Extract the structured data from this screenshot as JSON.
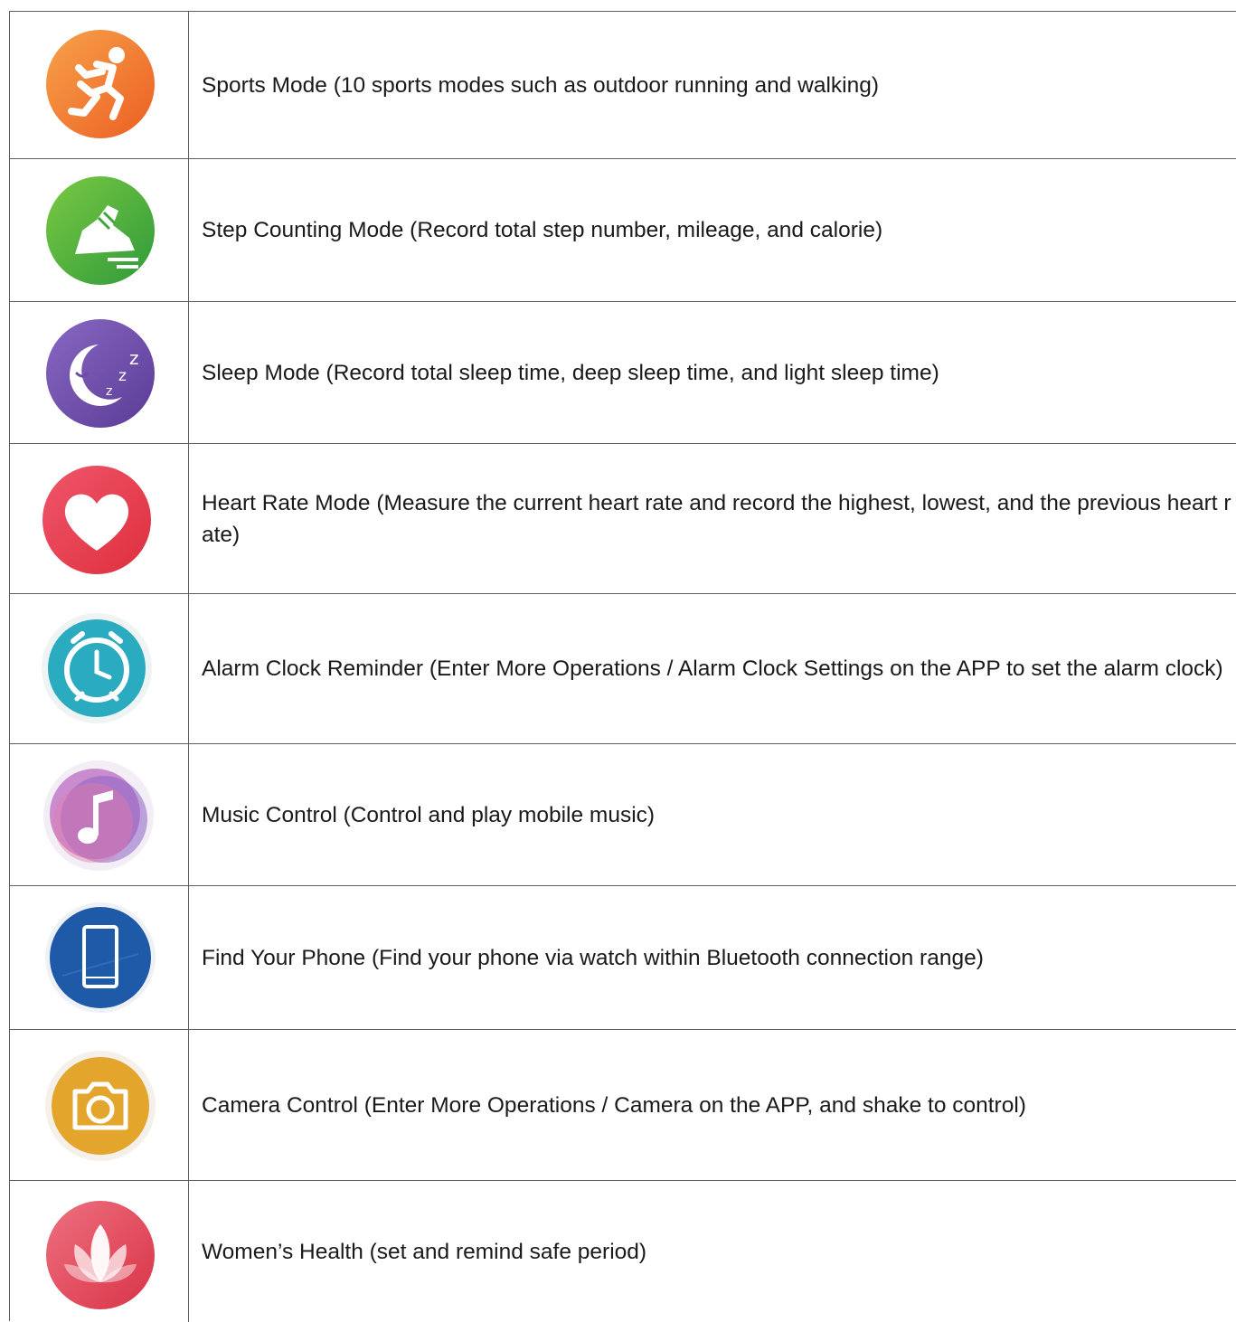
{
  "rows": [
    {
      "icon": "running-person-icon",
      "color": "#F0792F",
      "text": "Sports Mode (10 sports modes such as outdoor running and walking)"
    },
    {
      "icon": "sneaker-shoe-icon",
      "color": "#4DAF3C",
      "text": "Step Counting Mode (Record total step number, mileage, and calorie)"
    },
    {
      "icon": "moon-zzz-icon",
      "color": "#7150A8",
      "text": "Sleep Mode (Record total sleep time, deep sleep time, and light sleep time)"
    },
    {
      "icon": "heart-icon",
      "color": "#E9404E",
      "text": "Heart Rate Mode (Measure the current heart rate and record the highest, lowest, and the previous heart rate)"
    },
    {
      "icon": "alarm-clock-icon",
      "color": "#2AABC0",
      "text": "Alarm Clock Reminder (Enter More Operations / Alarm Clock Settings on the APP to set the alarm clock)"
    },
    {
      "icon": "music-note-icon",
      "color": "#A45DB0",
      "text": "Music Control (Control and play mobile music)"
    },
    {
      "icon": "phone-icon",
      "color": "#1E5AA8",
      "text": "Find Your Phone (Find your phone via watch within Bluetooth connection range)"
    },
    {
      "icon": "camera-icon",
      "color": "#E3A52B",
      "text": "Camera Control (Enter More Operations / Camera on the APP, and shake to control)"
    },
    {
      "icon": "lotus-flower-icon",
      "color": "#E24D5E",
      "text": "Women’s Health (set and remind safe period)"
    }
  ]
}
